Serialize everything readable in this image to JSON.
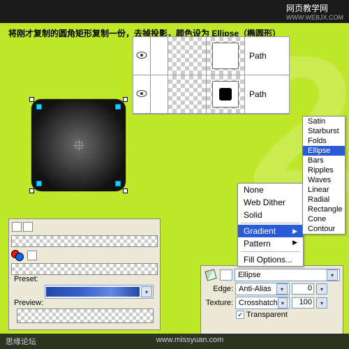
{
  "header": {
    "left": "",
    "right": "网页教学网",
    "site": "WWW.WEBJX.COM"
  },
  "instruction": "将刚才复制的圆角矩形复制一份，去掉投影，颜色设为 Ellipse（椭圆形）",
  "big_number": "2",
  "layers": {
    "rows": [
      {
        "name": "Path"
      },
      {
        "name": "Path"
      }
    ]
  },
  "shape_menu": {
    "items": [
      "Satin",
      "Starburst",
      "Folds",
      "Ellipse",
      "Bars",
      "Ripples",
      "Waves",
      "Linear",
      "Radial",
      "Rectangle",
      "Cone",
      "Contour"
    ],
    "selected": "Ellipse"
  },
  "grad_menu": {
    "top": [
      "None",
      "Web Dither",
      "Solid"
    ],
    "mid_hi": "Gradient",
    "mid": [
      "Pattern"
    ],
    "bot": [
      "Fill Options..."
    ]
  },
  "color_panel": {
    "preset_label": "Preset:",
    "preview_label": "Preview:"
  },
  "props_panel": {
    "fill_value": "Ellipse",
    "edge_label": "Edge:",
    "edge_value": "Anti-Alias",
    "edge_num": "0",
    "texture_label": "Texture:",
    "texture_value": "Crosshatch",
    "texture_num": "100",
    "transparent_label": "Transparent"
  },
  "footer": {
    "left": "思缘论坛",
    "center": "www.missyuan.com",
    "right": ""
  }
}
